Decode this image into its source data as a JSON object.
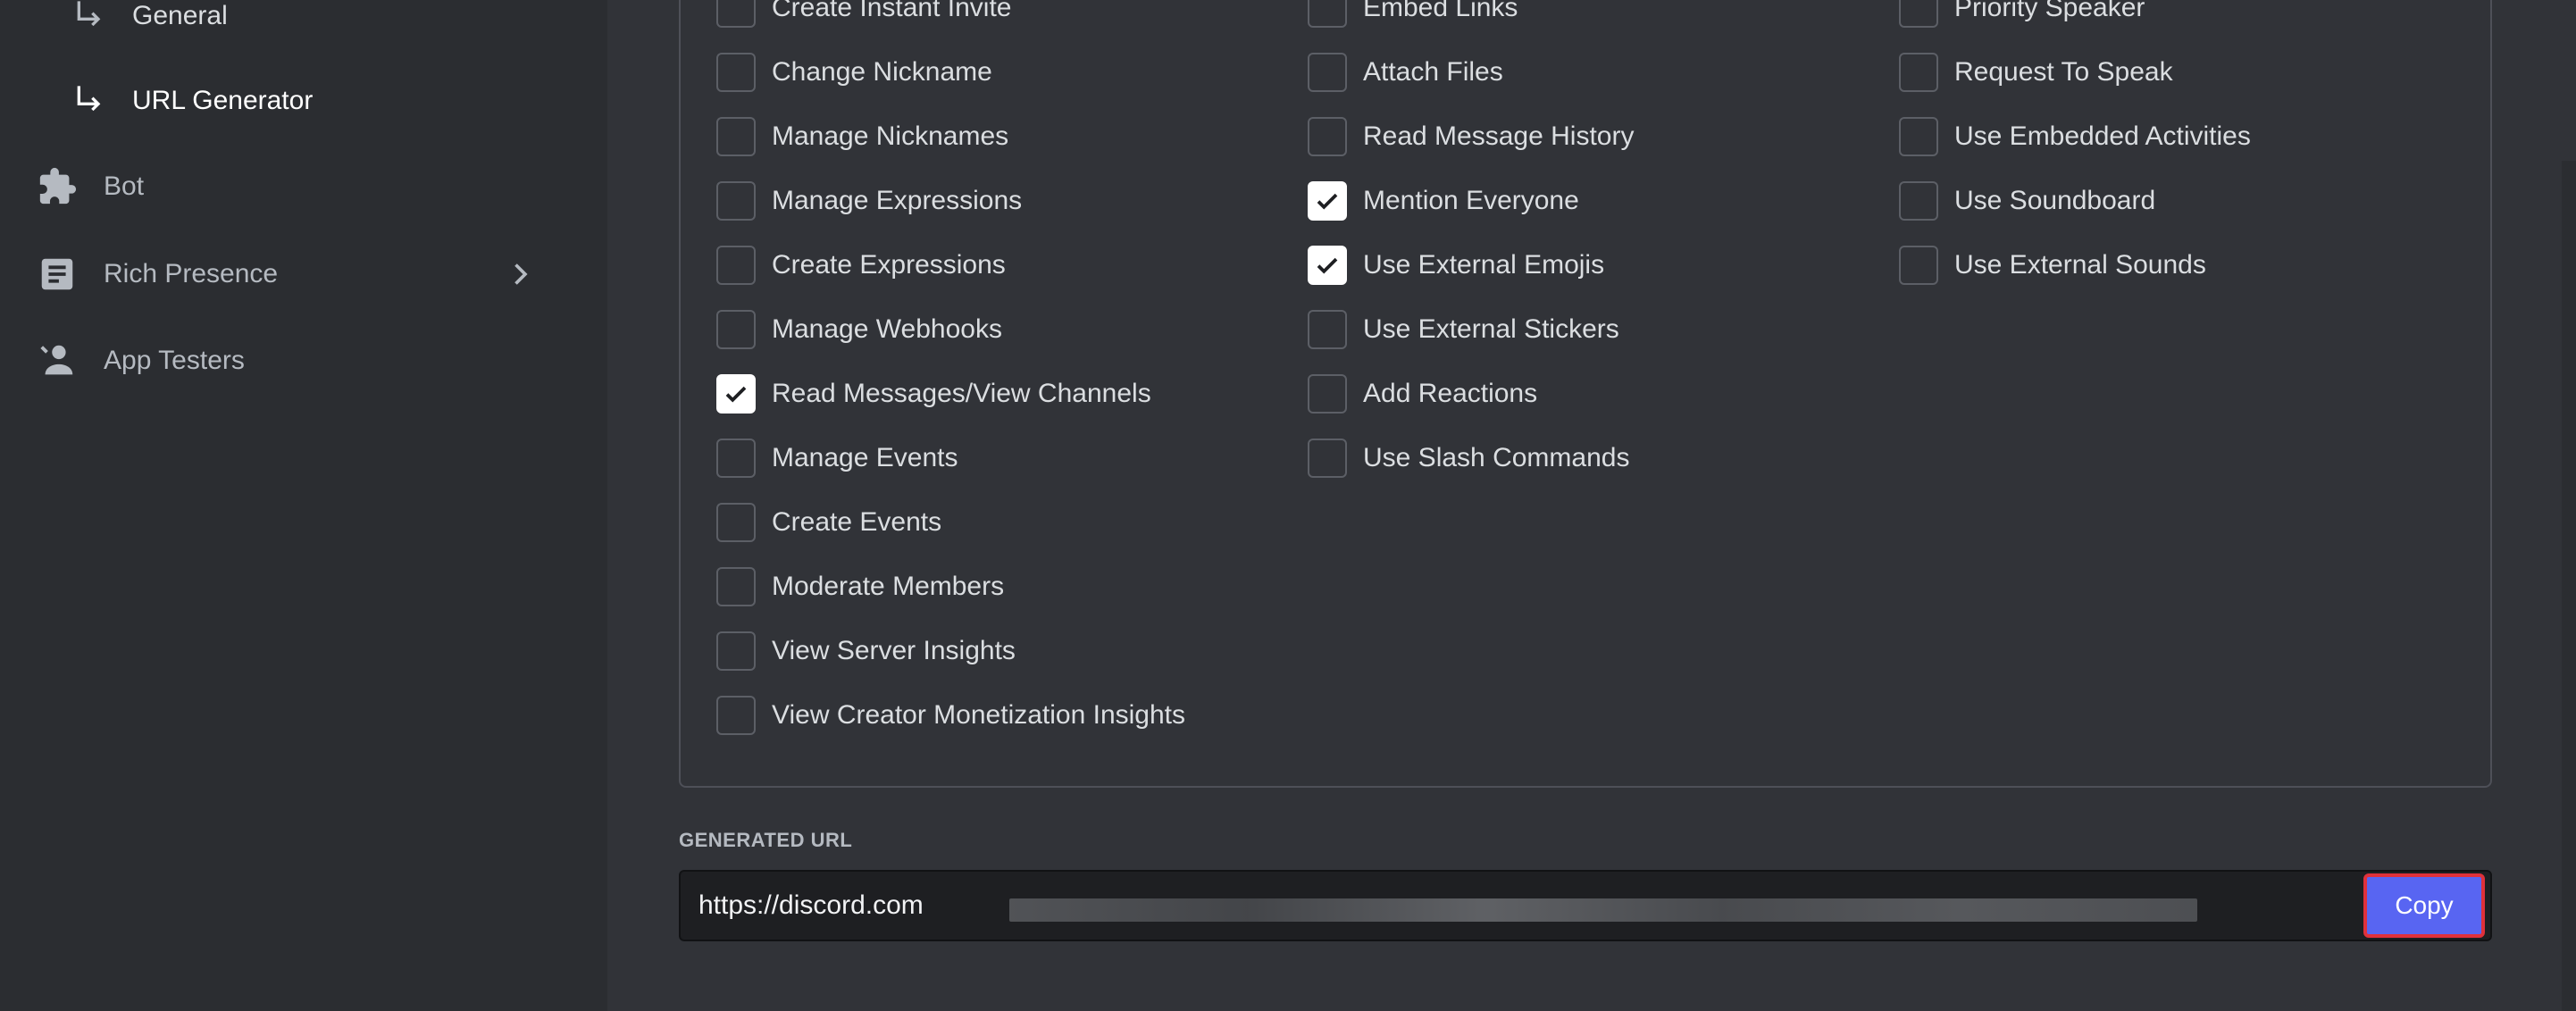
{
  "sidebar": {
    "subitems": [
      {
        "label": "General"
      },
      {
        "label": "URL Generator"
      }
    ],
    "items": [
      {
        "label": "Bot",
        "icon": "puzzle-icon"
      },
      {
        "label": "Rich Presence",
        "icon": "document-icon"
      },
      {
        "label": "App Testers",
        "icon": "user-testers-icon"
      }
    ]
  },
  "permissions": {
    "col1": [
      {
        "label": "Create Instant Invite",
        "checked": false
      },
      {
        "label": "Change Nickname",
        "checked": false
      },
      {
        "label": "Manage Nicknames",
        "checked": false
      },
      {
        "label": "Manage Expressions",
        "checked": false
      },
      {
        "label": "Create Expressions",
        "checked": false
      },
      {
        "label": "Manage Webhooks",
        "checked": false
      },
      {
        "label": "Read Messages/View Channels",
        "checked": true
      },
      {
        "label": "Manage Events",
        "checked": false
      },
      {
        "label": "Create Events",
        "checked": false
      },
      {
        "label": "Moderate Members",
        "checked": false
      },
      {
        "label": "View Server Insights",
        "checked": false
      },
      {
        "label": "View Creator Monetization Insights",
        "checked": false
      }
    ],
    "col2": [
      {
        "label": "Embed Links",
        "checked": false
      },
      {
        "label": "Attach Files",
        "checked": false
      },
      {
        "label": "Read Message History",
        "checked": false
      },
      {
        "label": "Mention Everyone",
        "checked": true
      },
      {
        "label": "Use External Emojis",
        "checked": true
      },
      {
        "label": "Use External Stickers",
        "checked": false
      },
      {
        "label": "Add Reactions",
        "checked": false
      },
      {
        "label": "Use Slash Commands",
        "checked": false
      }
    ],
    "col3": [
      {
        "label": "Priority Speaker",
        "checked": false
      },
      {
        "label": "Request To Speak",
        "checked": false
      },
      {
        "label": "Use Embedded Activities",
        "checked": false
      },
      {
        "label": "Use Soundboard",
        "checked": false
      },
      {
        "label": "Use External Sounds",
        "checked": false
      }
    ]
  },
  "generated_url": {
    "label": "GENERATED URL",
    "value": "https://discord.com",
    "copy_label": "Copy"
  },
  "colors": {
    "accent": "#5865f2",
    "highlight": "#e0313b"
  }
}
